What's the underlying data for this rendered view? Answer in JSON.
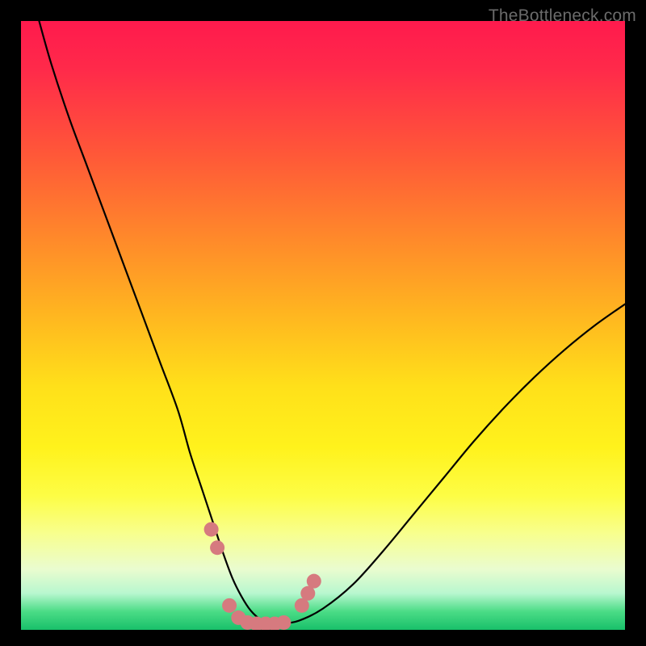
{
  "watermark": "TheBottleneck.com",
  "colors": {
    "frame": "#000000",
    "curve_stroke": "#000000",
    "marker_fill": "#d67a7f",
    "marker_stroke": "#bb5a60"
  },
  "chart_data": {
    "type": "line",
    "title": "",
    "xlabel": "",
    "ylabel": "",
    "xlim": [
      0,
      100
    ],
    "ylim": [
      0,
      100
    ],
    "grid": false,
    "legend": false,
    "x": [
      3,
      5,
      8,
      11,
      14,
      17,
      20,
      23,
      26,
      28,
      30,
      32,
      33.5,
      35,
      36.5,
      38,
      39.5,
      41,
      43,
      46,
      50,
      55,
      60,
      65,
      70,
      75,
      80,
      85,
      90,
      95,
      100
    ],
    "y": [
      100,
      93,
      84,
      76,
      68,
      60,
      52,
      44,
      36,
      29,
      23,
      17,
      12.5,
      8.5,
      5.5,
      3.2,
      1.8,
      1.0,
      1.0,
      1.5,
      3.5,
      7.5,
      13,
      19,
      25,
      31,
      36.5,
      41.5,
      46,
      50,
      53.5
    ],
    "markers": [
      {
        "x": 31.5,
        "y": 16.5
      },
      {
        "x": 32.5,
        "y": 13.5
      },
      {
        "x": 34.5,
        "y": 4.0
      },
      {
        "x": 36.0,
        "y": 2.0
      },
      {
        "x": 37.5,
        "y": 1.2
      },
      {
        "x": 39.0,
        "y": 1.0
      },
      {
        "x": 40.5,
        "y": 1.0
      },
      {
        "x": 42.0,
        "y": 1.0
      },
      {
        "x": 43.5,
        "y": 1.2
      },
      {
        "x": 46.5,
        "y": 4.0
      },
      {
        "x": 47.5,
        "y": 6.0
      },
      {
        "x": 48.5,
        "y": 8.0
      }
    ],
    "annotations": []
  }
}
